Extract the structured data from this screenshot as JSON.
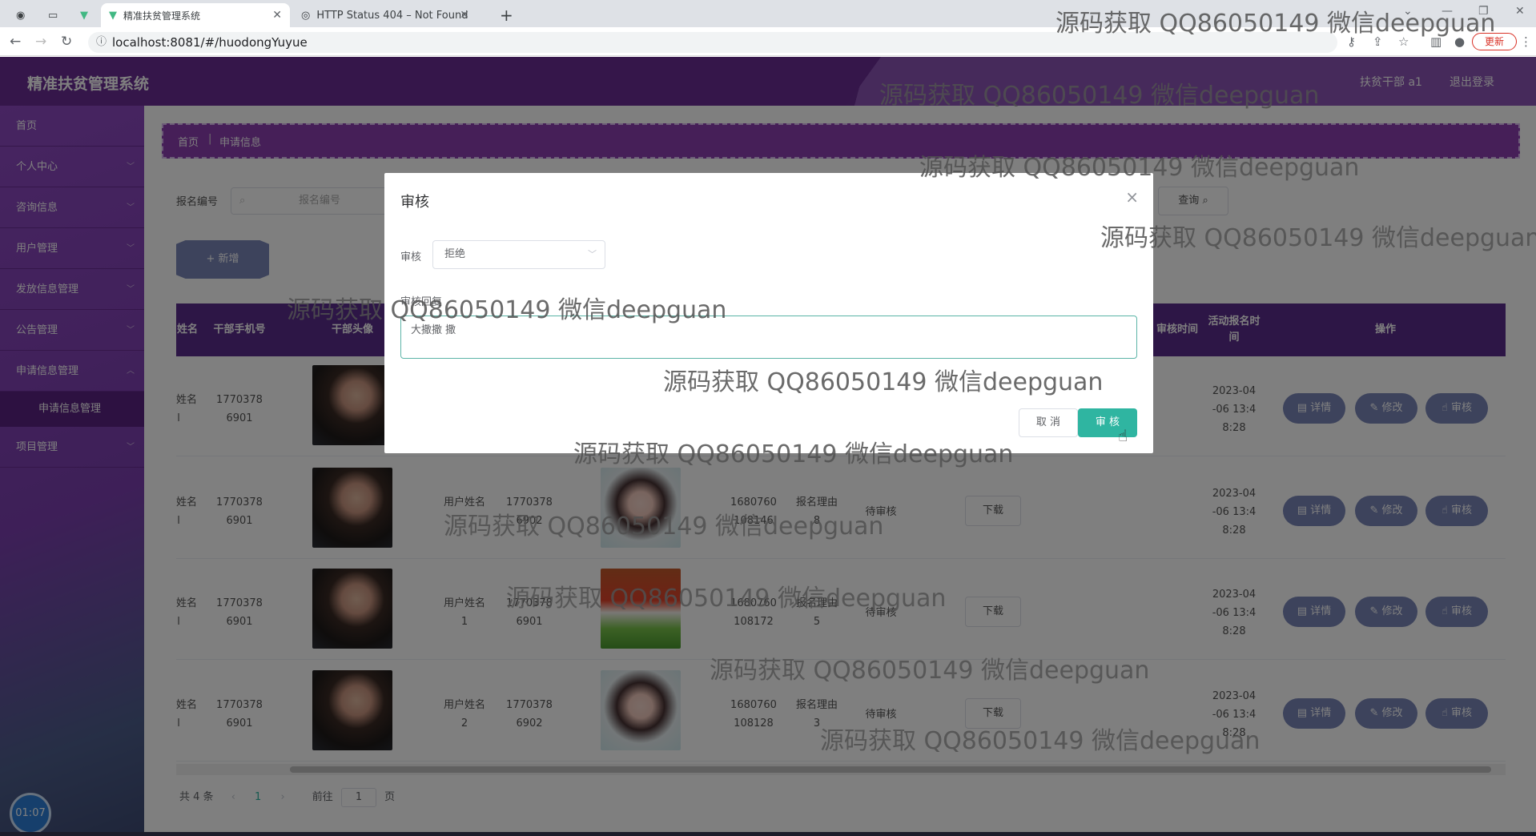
{
  "browser": {
    "tabs": [
      {
        "label": ""
      },
      {
        "label": ""
      },
      {
        "label": ""
      },
      {
        "label": "精准扶贫管理系统"
      },
      {
        "label": "HTTP Status 404 – Not Found"
      }
    ],
    "url": "localhost:8081/#/huodongYuyue",
    "update_label": "更新"
  },
  "header": {
    "title": "精准扶贫管理系统",
    "user": "扶贫干部 a1",
    "logout": "退出登录"
  },
  "sidebar": {
    "items": [
      {
        "label": "首页"
      },
      {
        "label": "个人中心"
      },
      {
        "label": "咨询信息"
      },
      {
        "label": "用户管理"
      },
      {
        "label": "发放信息管理"
      },
      {
        "label": "公告管理"
      },
      {
        "label": "申请信息管理"
      },
      {
        "label": "申请信息管理"
      },
      {
        "label": "项目管理"
      }
    ],
    "timer": "01:07"
  },
  "breadcrumb": {
    "home": "首页",
    "separator": "|",
    "current": "申请信息"
  },
  "search": {
    "label": "报名编号",
    "placeholder": "报名编号",
    "query_label": "查询"
  },
  "add_label": "+ 新增",
  "table": {
    "headers": [
      "姓名",
      "干部手机号",
      "干部头像",
      "审核时间",
      "活动报名时间",
      "操作"
    ],
    "rows": [
      {
        "name_frag": "姓名",
        "name_frag2": "l",
        "phone1": "1770378",
        "phone2": "6901",
        "user_name": "",
        "user_phone1": "",
        "user_phone2": "",
        "id1": "",
        "id2": "",
        "reason": "",
        "status": "",
        "time1": "2023-04",
        "time2": "-06 13:4",
        "time3": "8:28"
      },
      {
        "name_frag": "姓名",
        "name_frag2": "l",
        "phone1": "1770378",
        "phone2": "6901",
        "user_name": "用户姓名",
        "user_phone1": "1770378",
        "user_phone2": "6902",
        "id1": "1680760",
        "id2": "108146",
        "reason": "报名理由",
        "reason2": "8",
        "status": "待审核",
        "time1": "2023-04",
        "time2": "-06 13:4",
        "time3": "8:28"
      },
      {
        "name_frag": "姓名",
        "name_frag2": "l",
        "phone1": "1770378",
        "phone2": "6901",
        "user_name": "用户姓名",
        "user_name2": "1",
        "user_phone1": "1770378",
        "user_phone2": "6901",
        "id1": "1680760",
        "id2": "108172",
        "reason": "报名理由",
        "reason2": "5",
        "status": "待审核",
        "time1": "2023-04",
        "time2": "-06 13:4",
        "time3": "8:28"
      },
      {
        "name_frag": "姓名",
        "name_frag2": "l",
        "phone1": "1770378",
        "phone2": "6901",
        "user_name": "用户姓名",
        "user_name2": "2",
        "user_phone1": "1770378",
        "user_phone2": "6902",
        "id1": "1680760",
        "id2": "108128",
        "reason": "报名理由",
        "reason2": "3",
        "status": "待审核",
        "time1": "2023-04",
        "time2": "-06 13:4",
        "time3": "8:28"
      }
    ],
    "download_label": "下载",
    "detail_label": "详情",
    "edit_label": "修改",
    "audit_label": "审核"
  },
  "pager": {
    "total": "共 4 条",
    "page": "1",
    "goto": "前往",
    "goto_value": "1",
    "page_suffix": "页"
  },
  "dialog": {
    "title": "审核",
    "audit_label": "审核",
    "audit_value": "拒绝",
    "reply_label": "审核回复",
    "reply_value": "大撒撒 撒",
    "cancel_label": "取 消",
    "confirm_label": "审 核"
  },
  "watermark": "源码获取 QQ86050149 微信deepguan"
}
